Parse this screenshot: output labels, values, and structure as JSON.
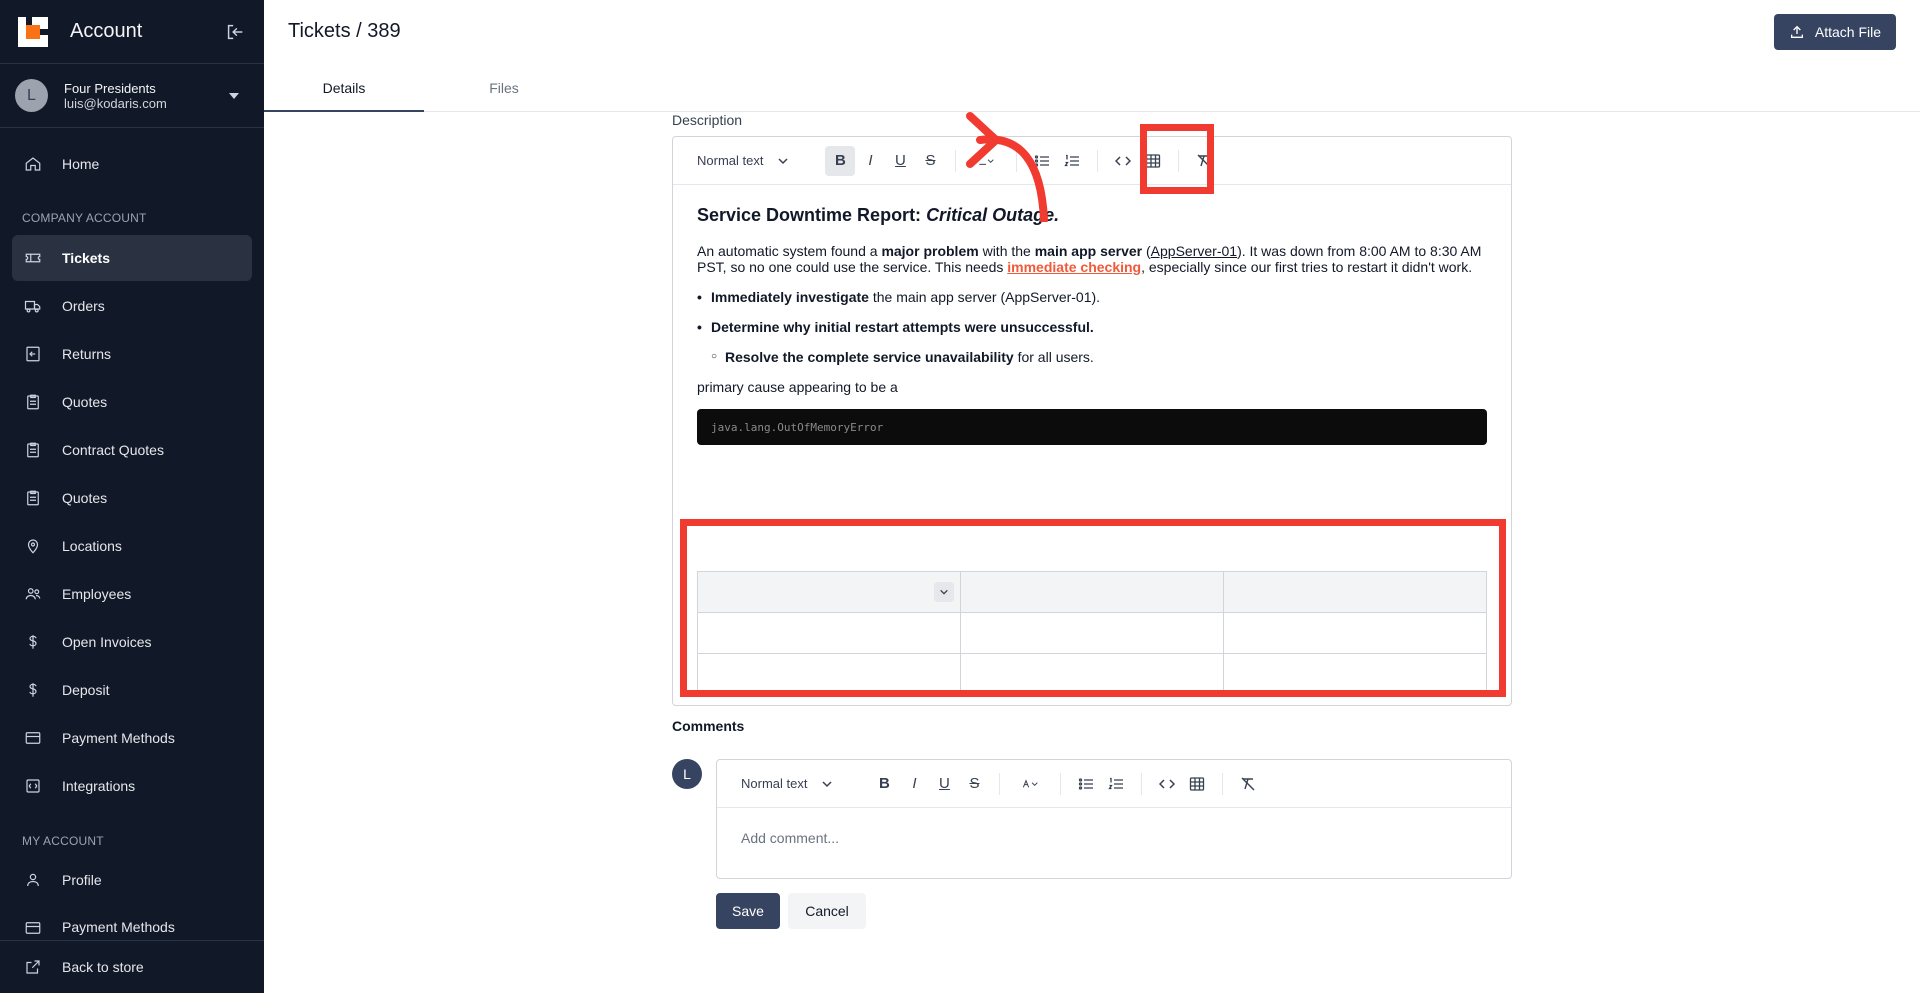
{
  "sidebar": {
    "title": "Account",
    "user": {
      "initial": "L",
      "name": "Four Presidents",
      "email": "luis@kodaris.com"
    },
    "items": [
      {
        "label": "Home",
        "icon": "home-icon"
      },
      {
        "label": "Tickets",
        "icon": "ticket-icon"
      },
      {
        "label": "Orders",
        "icon": "truck-icon"
      },
      {
        "label": "Returns",
        "icon": "return-icon"
      },
      {
        "label": "Quotes",
        "icon": "clipboard-icon"
      },
      {
        "label": "Contract Quotes",
        "icon": "clipboard-icon"
      },
      {
        "label": "Quotes",
        "icon": "clipboard-icon"
      },
      {
        "label": "Locations",
        "icon": "map-pin-icon"
      },
      {
        "label": "Employees",
        "icon": "users-icon"
      },
      {
        "label": "Open Invoices",
        "icon": "dollar-icon"
      },
      {
        "label": "Deposit",
        "icon": "dollar-icon"
      },
      {
        "label": "Payment Methods",
        "icon": "credit-card-icon"
      },
      {
        "label": "Integrations",
        "icon": "integration-icon"
      },
      {
        "label": "Profile",
        "icon": "user-icon"
      },
      {
        "label": "Payment Methods",
        "icon": "credit-card-icon"
      }
    ],
    "section_company": "COMPANY ACCOUNT",
    "section_my": "MY ACCOUNT",
    "back_label": "Back to store"
  },
  "header": {
    "title": "Tickets / 389",
    "attach_label": "Attach File",
    "tabs": [
      "Details",
      "Files"
    ]
  },
  "description": {
    "label": "Description",
    "block_type": "Normal text",
    "heading_plain": "Service Downtime Report: ",
    "heading_italic": "Critical Outage.",
    "p1_a": "An automatic system found a ",
    "p1_b": "major problem",
    "p1_c": " with the ",
    "p1_d": "main app server",
    "p1_e": " (",
    "p1_link": "AppServer-01",
    "p1_f": "). It was down from 8:00 AM to 8:30 AM PST, so no one could use the service. This needs ",
    "p1_red": "immediate checking",
    "p1_g": ", especially since our first tries to restart it didn't work.",
    "b1_bold": "Immediately investigate",
    "b1_rest": " the main app server (AppServer-01).",
    "b2_bold": "Determine why initial restart attempts were unsuccessful.",
    "s1_bold": "Resolve the complete service unavailability",
    "s1_rest": " for all users.",
    "p2": "primary cause appearing to be a",
    "code": "java.lang.OutOfMemoryError"
  },
  "comments": {
    "label": "Comments",
    "avatar_initial": "L",
    "block_type": "Normal text",
    "placeholder": "Add comment...",
    "save_label": "Save",
    "cancel_label": "Cancel"
  },
  "colors": {
    "sidebar_bg": "#111827",
    "accent": "#374461",
    "highlight": "#f13a30",
    "link_red": "#f05a3a"
  }
}
